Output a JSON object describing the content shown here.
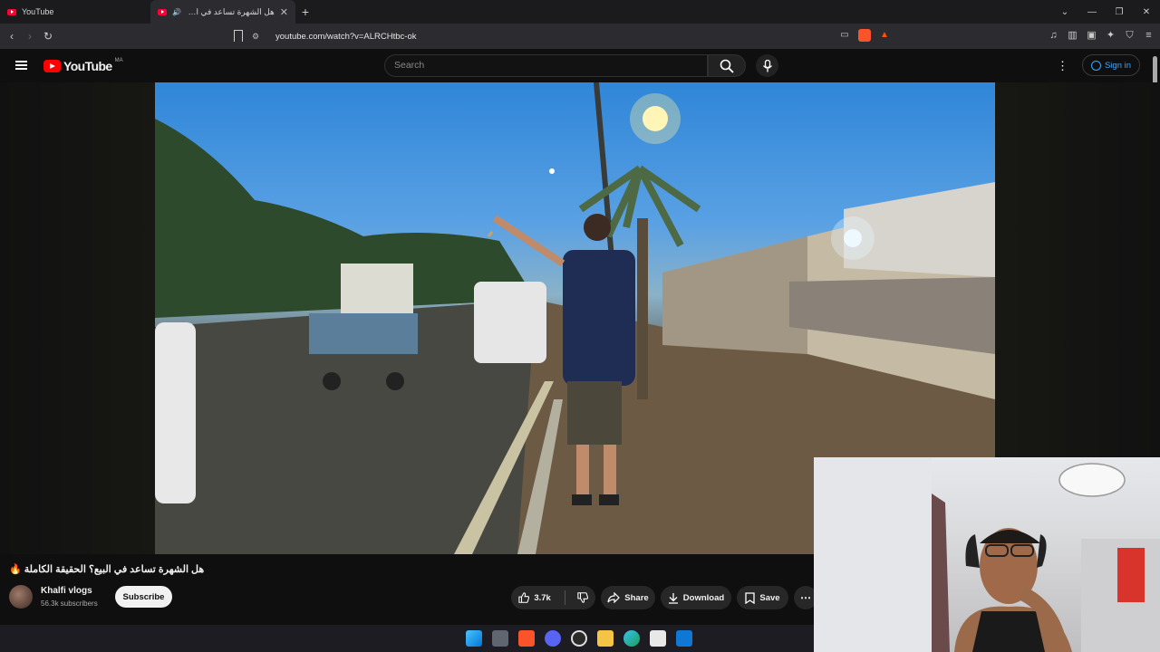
{
  "browser": {
    "tabs": [
      {
        "title": "YouTube",
        "active": false
      },
      {
        "title": "هل الشهرة تساعد في البيع؟ الـ",
        "active": true
      }
    ],
    "new_tab": "+",
    "url": "youtube.com/watch?v=ALRCHtbc-ok",
    "window_controls": [
      "⌄",
      "—",
      "❐",
      "✕"
    ]
  },
  "youtube": {
    "logo_text": "YouTube",
    "country_code": "MA",
    "search_placeholder": "Search",
    "sign_in": "Sign in",
    "more": "⋮"
  },
  "video": {
    "title": "هل الشهرة تساعد في البيع؟ الحقيقة الكاملة 🔥",
    "channel_name": "Khalfi vlogs",
    "subscribers": "56.3k subscribers",
    "subscribe_label": "Subscribe",
    "likes": "3.7k",
    "share_label": "Share",
    "download_label": "Download",
    "save_label": "Save",
    "more_label": "⋯"
  },
  "colors": {
    "youtube_red": "#ff0000",
    "link_blue": "#3ea6ff",
    "background": "#0f0f0f"
  },
  "taskbar": {
    "icons": [
      "windows-start-icon",
      "task-view-icon",
      "brave-icon",
      "discord-icon",
      "obs-icon",
      "file-explorer-icon",
      "edge-icon",
      "store-icon",
      "outlook-icon"
    ]
  }
}
